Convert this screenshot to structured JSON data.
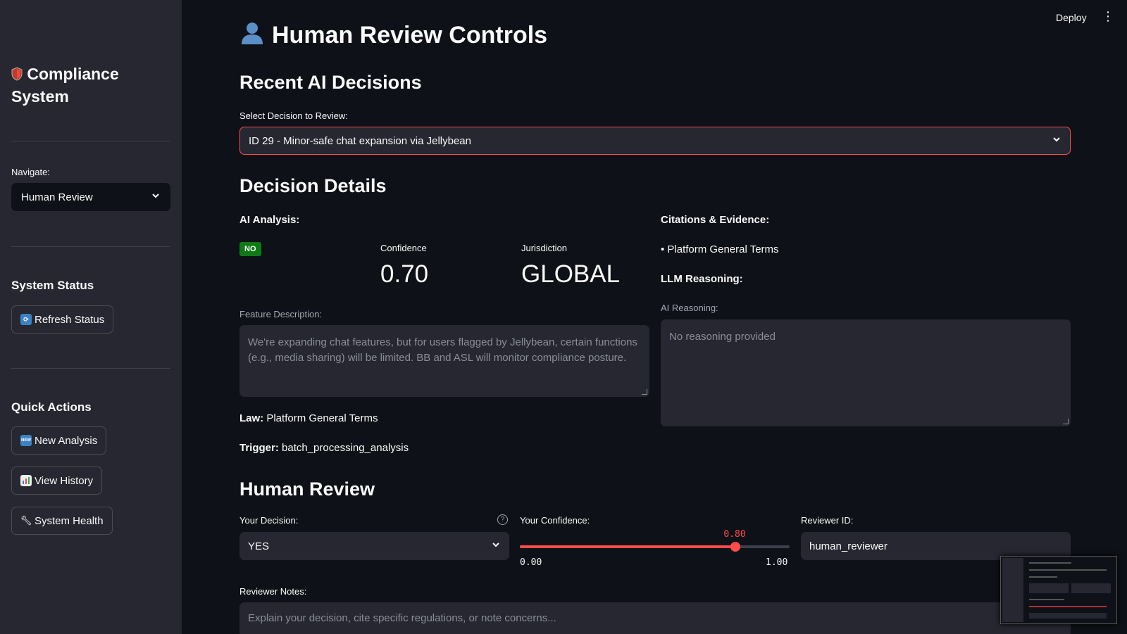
{
  "topbar": {
    "deploy_label": "Deploy"
  },
  "sidebar": {
    "app_title": "Compliance System",
    "navigate_label": "Navigate:",
    "navigate_value": "Human Review",
    "system_status_title": "System Status",
    "refresh_label": "Refresh Status",
    "quick_actions_title": "Quick Actions",
    "new_analysis_label": "New Analysis",
    "view_history_label": "View History",
    "system_health_label": "System Health"
  },
  "main": {
    "page_title": "Human Review Controls",
    "recent_title": "Recent AI Decisions",
    "select_label": "Select Decision to Review:",
    "select_value": "ID 29 - Minor-safe chat expansion via Jellybean",
    "details_title": "Decision Details",
    "ai_analysis_label": "AI Analysis:",
    "verdict_badge": "NO",
    "confidence_label": "Confidence",
    "confidence_value": "0.70",
    "jurisdiction_label": "Jurisdiction",
    "jurisdiction_value": "GLOBAL",
    "feature_desc_label": "Feature Description:",
    "feature_desc_value": "We're expanding chat features, but for users flagged by Jellybean, certain functions (e.g., media sharing) will be limited. BB and ASL will monitor compliance posture.",
    "law_key": "Law:",
    "law_value": "Platform General Terms",
    "trigger_key": "Trigger:",
    "trigger_value": "batch_processing_analysis",
    "citations_label": "Citations & Evidence:",
    "citation_item": "• Platform General Terms",
    "llm_reasoning_label": "LLM Reasoning:",
    "ai_reasoning_label": "AI Reasoning:",
    "ai_reasoning_value": "No reasoning provided"
  },
  "review": {
    "title": "Human Review",
    "decision_label": "Your Decision:",
    "decision_value": "YES",
    "confidence_label": "Your Confidence:",
    "confidence_value": "0.80",
    "confidence_fraction": 0.8,
    "slider_min": "0.00",
    "slider_max": "1.00",
    "reviewer_id_label": "Reviewer ID:",
    "reviewer_id_value": "human_reviewer",
    "notes_label": "Reviewer Notes:",
    "notes_placeholder": "Explain your decision, cite specific regulations, or note concerns..."
  },
  "icons": {
    "title_icon": "bust-in-silhouette-icon",
    "app_icon": "shield-icon",
    "refresh_icon": "refresh-arrows-icon",
    "new_icon": "new-badge-icon",
    "history_icon": "bar-chart-icon",
    "health_icon": "wrench-icon"
  },
  "colors": {
    "accent": "#ff4b4b",
    "badge_green": "#0d7a15",
    "bg": "#0e1117",
    "sidebar_bg": "#262730"
  }
}
